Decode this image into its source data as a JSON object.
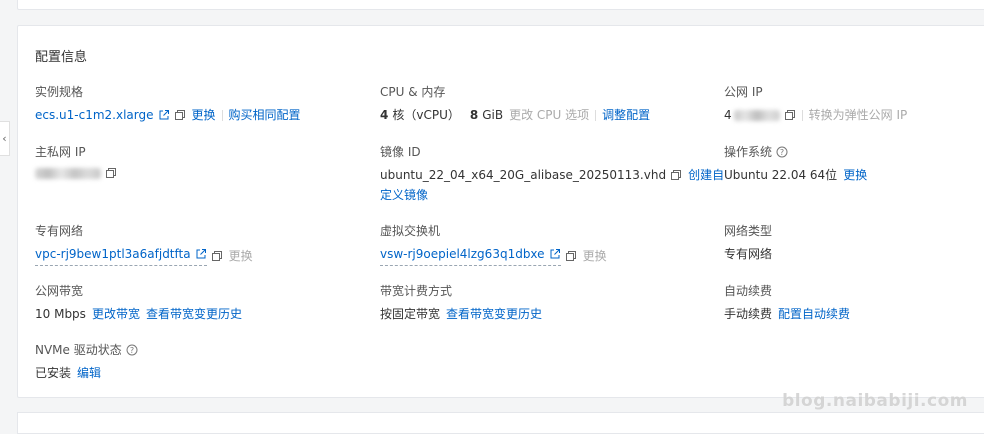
{
  "section_title": "配置信息",
  "instance_spec": {
    "label": "实例规格",
    "value": "ecs.u1-c1m2.xlarge",
    "change": "更换",
    "buy_same": "购买相同配置"
  },
  "cpu_memory": {
    "label": "CPU & 内存",
    "cpu_num": "4",
    "cpu_unit": "核（vCPU）",
    "mem_num": "8",
    "mem_unit": "GiB",
    "change_cpu": "更改 CPU 选项",
    "adjust": "调整配置"
  },
  "public_ip": {
    "label": "公网 IP",
    "value_prefix": "4",
    "convert": "转换为弹性公网 IP"
  },
  "private_ip": {
    "label": "主私网 IP"
  },
  "image": {
    "label": "镜像 ID",
    "value": "ubuntu_22_04_x64_20G_alibase_20250113.vhd",
    "create_a": "创建自",
    "create_b": "定义镜像"
  },
  "os": {
    "label": "操作系统",
    "value": "Ubuntu 22.04 64位",
    "change": "更换"
  },
  "vpc": {
    "label": "专有网络",
    "value": "vpc-rj9bew1ptl3a6afjdtfta",
    "change": "更换"
  },
  "vswitch": {
    "label": "虚拟交换机",
    "value": "vsw-rj9oepiel4lzg63q1dbxe",
    "change": "更换"
  },
  "network_type": {
    "label": "网络类型",
    "value": "专有网络"
  },
  "bandwidth": {
    "label": "公网带宽",
    "value": "10 Mbps",
    "change": "更改带宽",
    "history": "查看带宽变更历史"
  },
  "billing": {
    "label": "带宽计费方式",
    "value": "按固定带宽",
    "history": "查看带宽变更历史"
  },
  "auto_renew": {
    "label": "自动续费",
    "value": "手动续费",
    "config": "配置自动续费"
  },
  "nvme": {
    "label": "NVMe 驱动状态",
    "value": "已安装",
    "edit": "编辑"
  },
  "side_handle_icon": "chevron-left-icon",
  "watermark": "blog.naibabiji.com",
  "colors": {
    "link": "#0064c8",
    "muted": "#aaaaaa",
    "text": "#333333"
  }
}
